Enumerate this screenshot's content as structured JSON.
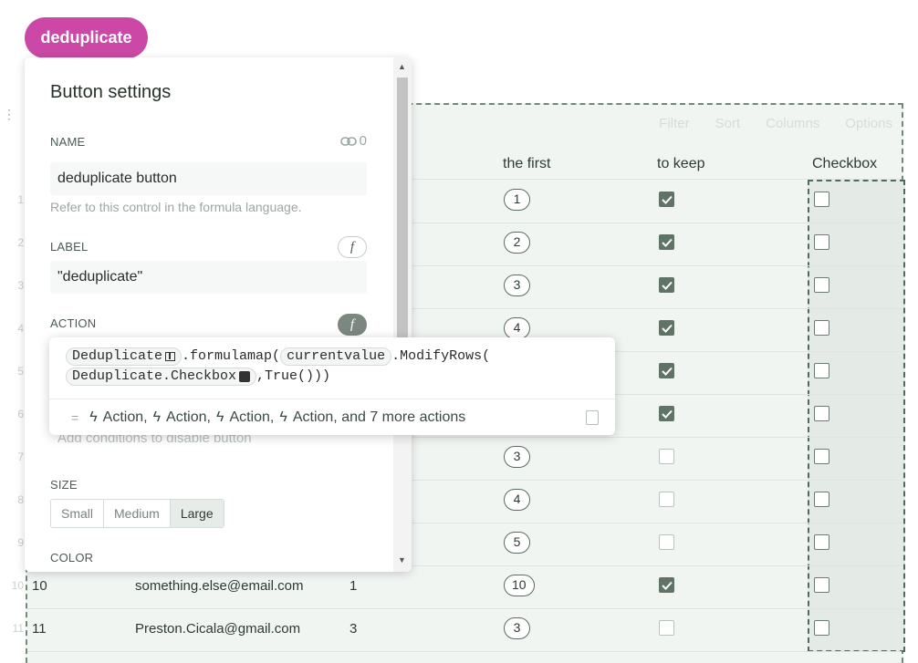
{
  "top_button": {
    "label": "deduplicate"
  },
  "toolbar": {
    "items": [
      "Filter",
      "Sort",
      "Columns",
      "Options"
    ]
  },
  "table": {
    "headers": {
      "first": "the first",
      "keep": "to keep",
      "checkbox": "Checkbox"
    },
    "rows": [
      {
        "num": "1",
        "a": "",
        "b": "",
        "first": "1",
        "keep": true,
        "checkbox": false
      },
      {
        "num": "2",
        "a": "",
        "b": "",
        "first": "2",
        "keep": true,
        "checkbox": false
      },
      {
        "num": "3",
        "a": "",
        "b": "",
        "first": "3",
        "keep": true,
        "checkbox": false
      },
      {
        "num": "4",
        "a": "",
        "b": "",
        "first": "4",
        "keep": true,
        "checkbox": false
      },
      {
        "num": "5",
        "a": "",
        "b": "",
        "first": "",
        "keep": true,
        "checkbox": false
      },
      {
        "num": "6",
        "a": "",
        "b": "",
        "first": "",
        "keep": true,
        "checkbox": false
      },
      {
        "num": "7",
        "a": "",
        "b": "",
        "first": "3",
        "keep": false,
        "checkbox": false
      },
      {
        "num": "8",
        "a": "",
        "b": "",
        "first": "4",
        "keep": false,
        "checkbox": false
      },
      {
        "num": "9",
        "a": "",
        "b": "",
        "first": "5",
        "keep": false,
        "checkbox": false
      },
      {
        "num": "10",
        "a": "something.else@email.com",
        "b": "1",
        "first": "10",
        "keep": true,
        "checkbox": false
      },
      {
        "num": "11",
        "a": "Preston.Cicala@gmail.com",
        "b": "3",
        "first": "3",
        "keep": false,
        "checkbox": false
      }
    ],
    "visible_row_labels": [
      "10",
      "11"
    ]
  },
  "panel": {
    "title": "Button settings",
    "name_label": "NAME",
    "name_link_count": "0",
    "name_value": "deduplicate button",
    "name_hint": "Refer to this control in the formula language.",
    "label_label": "LABEL",
    "label_value": "\"deduplicate\"",
    "action_label": "ACTION",
    "disable_placeholder": "Add conditions to disable button",
    "size_label": "SIZE",
    "size_options": [
      "Small",
      "Medium",
      "Large"
    ],
    "size_selected": "Large",
    "color_label": "COLOR"
  },
  "formula": {
    "token_table": "Deduplicate",
    "part1": ".formulamap(",
    "token_current": "currentvalue",
    "part2": ".ModifyRows(",
    "token_column": "Deduplicate.Checkbox",
    "part3": ",True()))",
    "result_action": "Action,",
    "result_last": "Action, and 7 more actions"
  },
  "icons": {
    "link": "link-icon",
    "formula": "fx-icon",
    "bolt": "lightning-icon",
    "copy": "copy-icon",
    "table": "table-icon",
    "checkbox": "checkbox-icon"
  },
  "colors": {
    "accent": "#cc48a6",
    "checked": "#5f7466"
  }
}
